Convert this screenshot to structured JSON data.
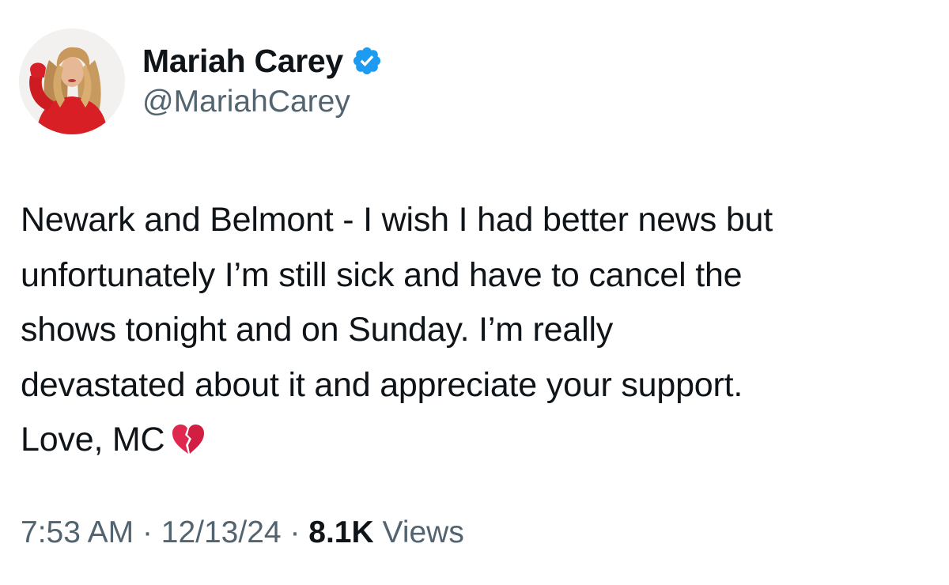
{
  "author": {
    "display_name": "Mariah Carey",
    "handle": "@MariahCarey",
    "verified": true
  },
  "tweet": {
    "lines": [
      "Newark and Belmont - I wish I had better news but",
      "unfortunately I’m still sick and have to cancel the",
      "shows tonight and on Sunday. I’m really",
      "devastated about it and appreciate your support.",
      "Love, MC"
    ],
    "emoji": "broken-heart-icon"
  },
  "meta": {
    "time": "7:53 AM",
    "separator": "·",
    "date": "12/13/24",
    "views_count": "8.1K",
    "views_label": "Views"
  },
  "colors": {
    "text_primary": "#0f1419",
    "text_secondary": "#536471",
    "verified_blue": "#1d9bf0",
    "heart_red": "#e0284e"
  }
}
